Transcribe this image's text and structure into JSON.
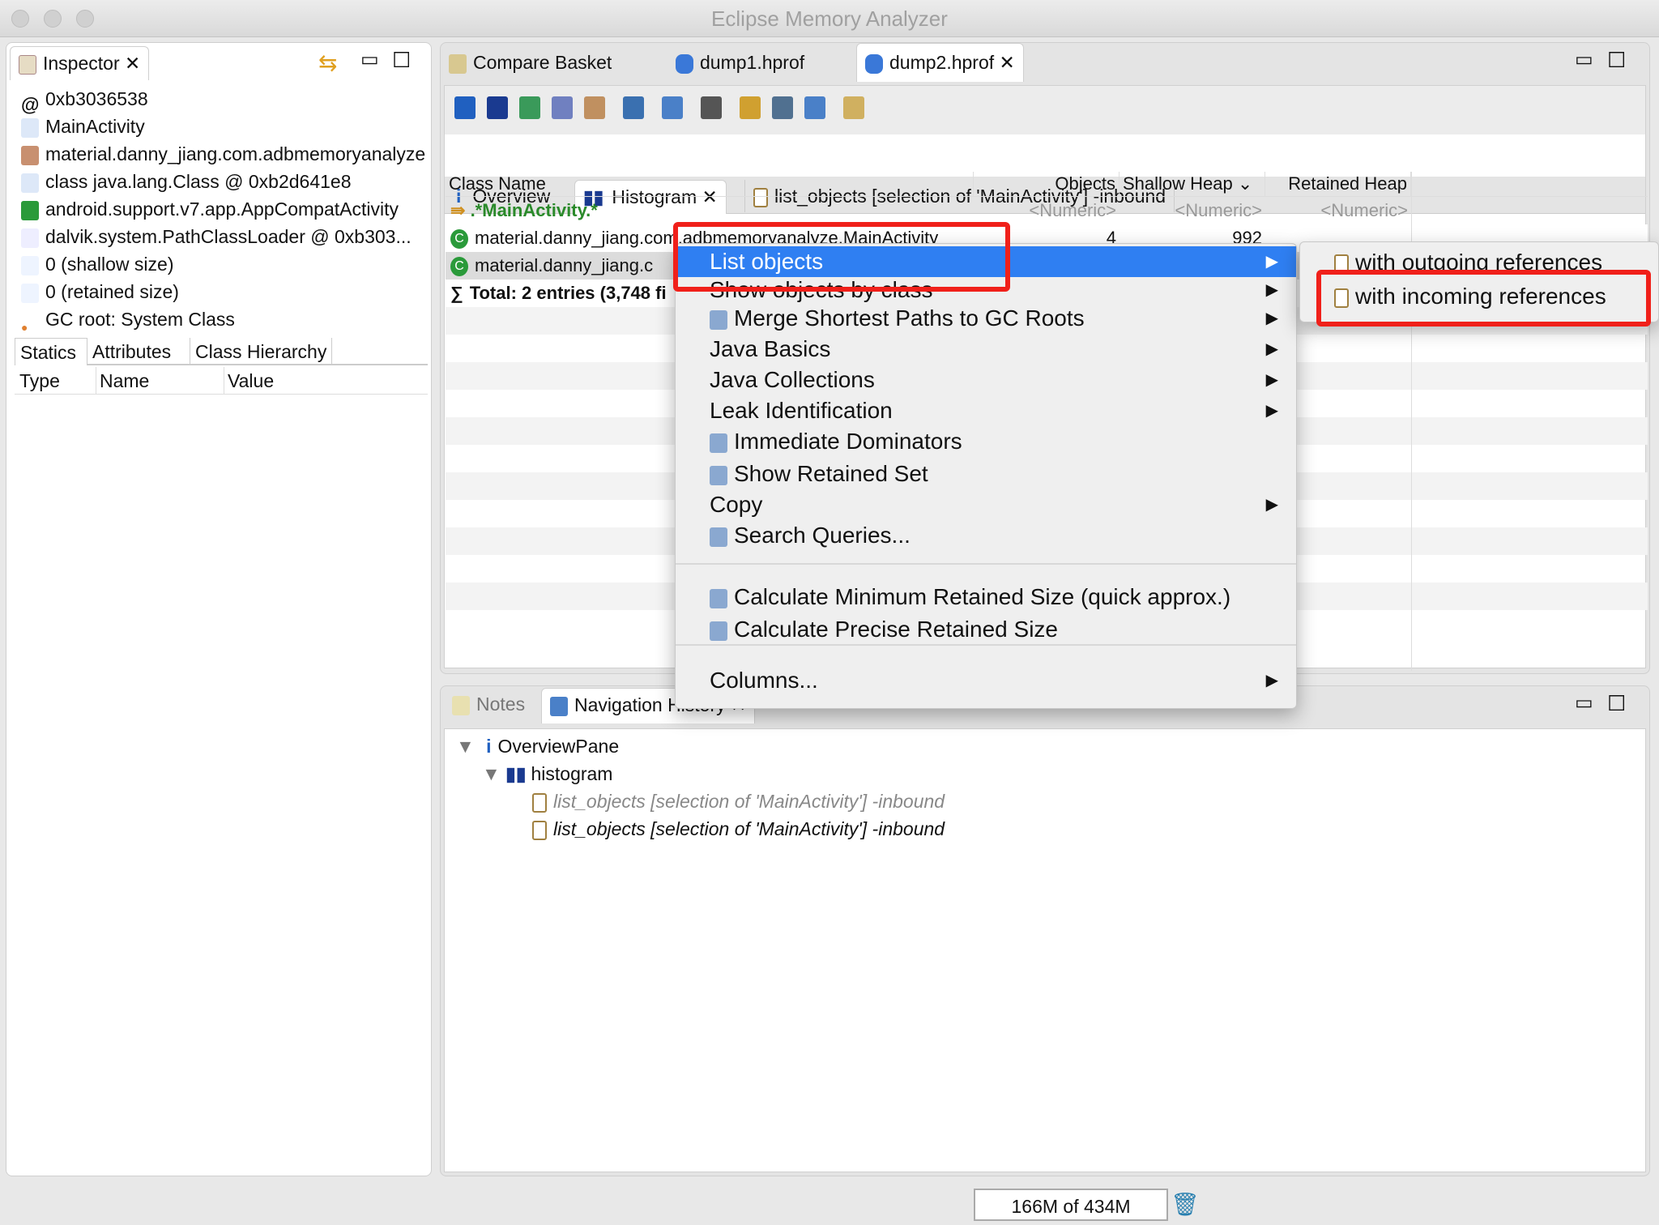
{
  "window": {
    "title": "Eclipse Memory Analyzer"
  },
  "inspector": {
    "tab_label": "Inspector",
    "items": [
      {
        "icon": "address-icon",
        "label": "0xb3036538"
      },
      {
        "icon": "class-icon",
        "label": "MainActivity"
      },
      {
        "icon": "package-icon",
        "label": "material.danny_jiang.com.adbmemoryanalyze"
      },
      {
        "icon": "class-icon",
        "label": "class java.lang.Class @ 0xb2d641e8"
      },
      {
        "icon": "superclass-icon",
        "label": "android.support.v7.app.AppCompatActivity"
      },
      {
        "icon": "classloader-icon",
        "label": "dalvik.system.PathClassLoader @ 0xb303..."
      },
      {
        "icon": "size-icon",
        "label": "0 (shallow size)"
      },
      {
        "icon": "size-icon",
        "label": "0 (retained size)"
      },
      {
        "icon": "gc-root-icon",
        "label": "GC root: System Class"
      }
    ],
    "subtabs": [
      "Statics",
      "Attributes",
      "Class Hierarchy"
    ],
    "columns": [
      "Type",
      "Name",
      "Value"
    ]
  },
  "editor": {
    "tabs": [
      {
        "label": "Compare Basket",
        "icon": "compare-basket-icon"
      },
      {
        "label": "dump1.hprof",
        "icon": "heap-dump-icon"
      },
      {
        "label": "dump2.hprof",
        "icon": "heap-dump-icon",
        "active": true
      }
    ],
    "toolbar": [
      "info-icon",
      "histogram-icon",
      "dominator-tree-icon",
      "oql-icon",
      "gear-icon",
      "run-report-icon",
      "query-browser-icon",
      "search-icon",
      "group-icon",
      "calculator-icon",
      "export-icon",
      "compare-icon"
    ],
    "subtabs": [
      {
        "label": "Overview"
      },
      {
        "label": "Histogram",
        "active": true
      },
      {
        "label": "list_objects [selection of 'MainActivity'] -inbound"
      }
    ],
    "table": {
      "columns": [
        "Class Name",
        "Objects",
        "Shallow Heap",
        "Retained Heap"
      ],
      "filter": {
        "name": ".*MainActivity.*",
        "objects": "<Numeric>",
        "shallow": "<Numeric>",
        "retained": "<Numeric>"
      },
      "rows": [
        {
          "name": "material.danny_jiang.com.adbmemoryanalyze.MainActivity",
          "objects": "4",
          "shallow": "992"
        },
        {
          "name": "material.danny_jiang.c"
        },
        {
          "name": "Total: 2 entries (3,748 fi"
        }
      ]
    }
  },
  "context_menu": {
    "items": [
      {
        "label": "List objects",
        "submenu": true,
        "highlighted": true
      },
      {
        "label": "Show objects by class",
        "submenu": true
      },
      {
        "label": "Merge Shortest Paths to GC Roots",
        "submenu": true,
        "icon": "merge-paths-icon"
      },
      {
        "label": "Java Basics",
        "submenu": true
      },
      {
        "label": "Java Collections",
        "submenu": true
      },
      {
        "label": "Leak Identification",
        "submenu": true
      },
      {
        "label": "Immediate Dominators",
        "icon": "dominators-icon"
      },
      {
        "label": "Show Retained Set",
        "icon": "retained-set-icon"
      },
      {
        "label": "Copy",
        "submenu": true
      },
      {
        "label": "Search Queries...",
        "icon": "search-queries-icon"
      },
      {
        "label": "Calculate Minimum Retained Size (quick approx.)",
        "icon": "calculator-icon"
      },
      {
        "label": "Calculate Precise Retained Size",
        "icon": "calculator-icon"
      },
      {
        "label": "Columns...",
        "submenu": true
      }
    ],
    "submenu": [
      "with outgoing references",
      "with incoming references"
    ]
  },
  "bottom": {
    "tabs": [
      "Notes",
      "Navigation History"
    ],
    "tree": [
      "OverviewPane",
      "histogram",
      "list_objects [selection of 'MainActivity'] -inbound",
      "list_objects [selection of 'MainActivity'] -inbound"
    ]
  },
  "status": {
    "heap": "166M of 434M"
  },
  "colors": {
    "highlight": "#2f7ff2",
    "annotation": "#f0201a",
    "filter_text": "#2a8a2a"
  }
}
